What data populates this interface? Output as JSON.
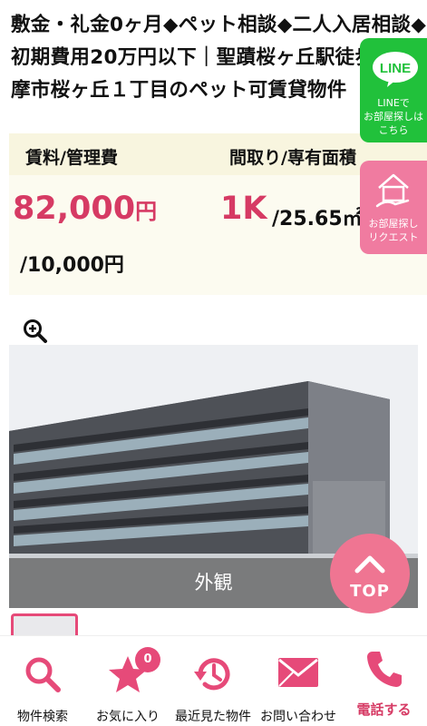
{
  "listing": {
    "title": "敷金・礼金0ヶ月◆ペット相談◆二人入居相談◆初期費用20万円以下｜聖蹟桜ヶ丘駅徒歩6分多摩市桜ヶ丘１丁目のペット可賃貸物件"
  },
  "summary": {
    "rent_label": "賃料/管理費",
    "layout_label": "間取り/専有面積",
    "rent_value": "82,000",
    "yen_unit": "円",
    "fee_value": "/10,000円",
    "layout_value": "1K",
    "area_value": "/25.65㎡"
  },
  "gallery": {
    "caption": "外観"
  },
  "top_button": {
    "label": "TOP"
  },
  "side_line": {
    "title": "LINE",
    "text": "LINEで\nお部屋探しは\nこちら"
  },
  "side_request": {
    "text": "お部屋探し\nリクエスト"
  },
  "bottom_nav": {
    "search": "物件検索",
    "favorites": "お気に入り",
    "favorites_count": "0",
    "history": "最近見た物件",
    "contact": "お問い合わせ",
    "phone": "電話する"
  },
  "colors": {
    "accent": "#d63a64",
    "line_green": "#21c13b",
    "pink_button": "#ef7592"
  }
}
